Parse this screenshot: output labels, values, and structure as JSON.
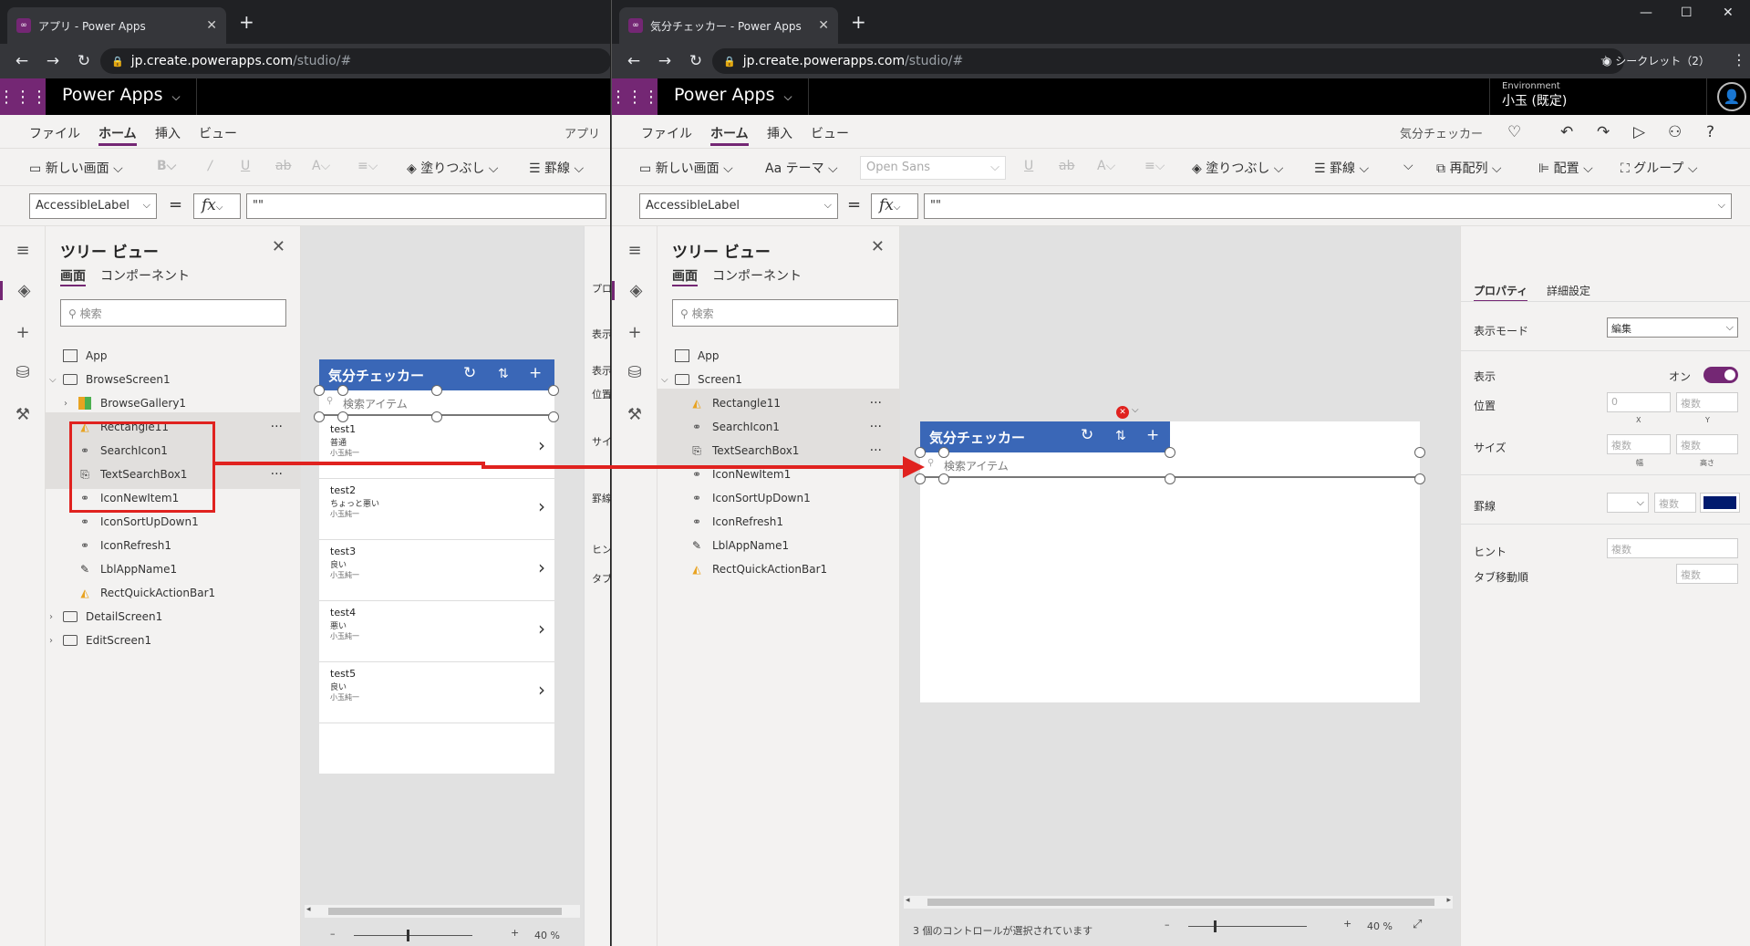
{
  "left": {
    "tab_title": "アプリ - Power Apps",
    "url_domain": "jp.create.powerapps.com",
    "url_path": "/studio/#",
    "app_name": "Power Apps",
    "menus": [
      "ファイル",
      "ホーム",
      "挿入",
      "ビュー"
    ],
    "menu_right": "アプリ",
    "toolbar": {
      "new_screen": "新しい画面",
      "fill": "塗りつぶし",
      "border": "罫線"
    },
    "property": "AccessibleLabel",
    "formula": "\"\"",
    "tree_title": "ツリー ビュー",
    "tree_tabs": [
      "画面",
      "コンポーネント"
    ],
    "search_placeholder": "検索",
    "tree_items": [
      {
        "label": "App",
        "icon": "app"
      },
      {
        "label": "BrowseScreen1",
        "icon": "screen",
        "expand": "v"
      },
      {
        "label": "BrowseGallery1",
        "icon": "gallery",
        "expand": ">"
      },
      {
        "label": "Rectangle11",
        "icon": "rect",
        "selected": true,
        "dots": "···"
      },
      {
        "label": "SearchIcon1",
        "icon": "icon",
        "selected": true
      },
      {
        "label": "TextSearchBox1",
        "icon": "text",
        "selected": true,
        "dots": "···"
      },
      {
        "label": "IconNewItem1",
        "icon": "icon"
      },
      {
        "label": "IconSortUpDown1",
        "icon": "icon"
      },
      {
        "label": "IconRefresh1",
        "icon": "icon"
      },
      {
        "label": "LblAppName1",
        "icon": "label"
      },
      {
        "label": "RectQuickActionBar1",
        "icon": "rect"
      },
      {
        "label": "DetailScreen1",
        "icon": "screen",
        "expand": ">"
      },
      {
        "label": "EditScreen1",
        "icon": "screen",
        "expand": ">"
      }
    ],
    "app_header": "気分チェッカー",
    "search_box": "検索アイテム",
    "gallery": [
      {
        "title": "test1",
        "sub": "普通",
        "user": "小玉純一"
      },
      {
        "title": "test2",
        "sub": "ちょっと悪い",
        "user": "小玉純一"
      },
      {
        "title": "test3",
        "sub": "良い",
        "user": "小玉純一"
      },
      {
        "title": "test4",
        "sub": "悪い",
        "user": "小玉純一"
      },
      {
        "title": "test5",
        "sub": "良い",
        "user": "小玉純一"
      }
    ],
    "panel_edge": [
      "プロ",
      "表示",
      "表示",
      "位置",
      "サイ",
      "罫線",
      "ヒン",
      "タブ"
    ],
    "zoom": "40 %"
  },
  "right": {
    "tab_title": "気分チェッカー - Power Apps",
    "url_domain": "jp.create.powerapps.com",
    "url_path": "/studio/#",
    "incognito": "シークレット（2）",
    "app_name": "Power Apps",
    "env_label": "Environment",
    "env_value": "小玉 (既定)",
    "menus": [
      "ファイル",
      "ホーム",
      "挿入",
      "ビュー"
    ],
    "menu_right": "気分チェッカー",
    "toolbar": {
      "new_screen": "新しい画面",
      "theme": "テーマ",
      "font": "Open Sans",
      "fill": "塗りつぶし",
      "border": "罫線",
      "reorder": "再配列",
      "align": "配置",
      "group": "グループ"
    },
    "property": "AccessibleLabel",
    "formula": "\"\"",
    "tree_title": "ツリー ビュー",
    "tree_tabs": [
      "画面",
      "コンポーネント"
    ],
    "search_placeholder": "検索",
    "tree_items": [
      {
        "label": "App",
        "icon": "app"
      },
      {
        "label": "Screen1",
        "icon": "screen",
        "expand": "v"
      },
      {
        "label": "Rectangle11",
        "icon": "rect",
        "selected": true,
        "dots": "···"
      },
      {
        "label": "SearchIcon1",
        "icon": "icon",
        "selected": true,
        "dots": "···"
      },
      {
        "label": "TextSearchBox1",
        "icon": "text",
        "selected": true,
        "dots": "···"
      },
      {
        "label": "IconNewItem1",
        "icon": "icon"
      },
      {
        "label": "IconSortUpDown1",
        "icon": "icon"
      },
      {
        "label": "IconRefresh1",
        "icon": "icon"
      },
      {
        "label": "LblAppName1",
        "icon": "label"
      },
      {
        "label": "RectQuickActionBar1",
        "icon": "rect"
      }
    ],
    "app_header": "気分チェッカー",
    "search_box": "検索アイテム",
    "props": {
      "tabs": [
        "プロパティ",
        "詳細設定"
      ],
      "display_mode_label": "表示モード",
      "display_mode_value": "編集",
      "visible_label": "表示",
      "visible_value": "オン",
      "position_label": "位置",
      "position_x": "0",
      "position_y": "複数",
      "x_label": "X",
      "y_label": "Y",
      "size_label": "サイズ",
      "width_value": "複数",
      "height_value": "複数",
      "width_label": "幅",
      "height_label": "高さ",
      "border_label": "罫線",
      "border_value": "複数",
      "border_color": "#001a6e",
      "hint_label": "ヒント",
      "hint_value": "複数",
      "tab_label": "タブ移動順",
      "tab_value": "複数"
    },
    "status": "3 個のコントロールが選択されています",
    "zoom": "40 %"
  },
  "colors": {
    "accent": "#742774",
    "header_blue": "#3a67b7",
    "highlight_red": "#e0221f"
  }
}
